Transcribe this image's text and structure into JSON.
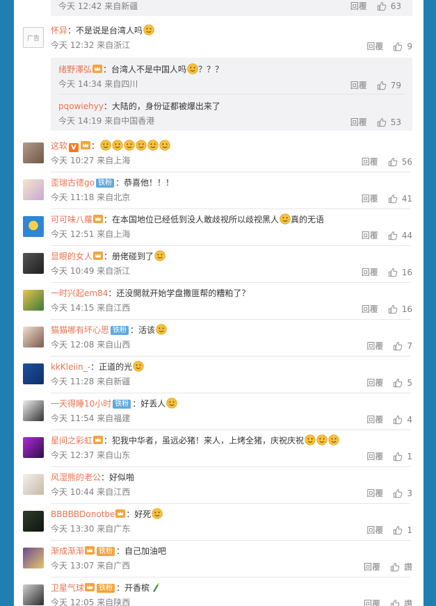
{
  "colors": {
    "page_bg": "#1f7fb3",
    "name": "#eb7350",
    "meta": "#808080",
    "sub_bg": "#f2f2f5"
  },
  "labels": {
    "reply": "回覆"
  },
  "top_sub": {
    "time": "今天 12:42 来自新疆",
    "likes": "63"
  },
  "ad_comment": {
    "avatar_text": "广告",
    "name": "怀异",
    "text": "：不是说是台湾人吗",
    "time": "今天 12:32 来自浙江",
    "likes": "9",
    "replies": [
      {
        "name": "绪野澤弘",
        "text": "：台湾人不是中国人吗",
        "suffix": "？？？",
        "time": "今天 14:34 来自四川",
        "likes": "79"
      },
      {
        "name": "pqowiehyy",
        "text": "：大陆的，身份证都被爆出来了",
        "time": "今天 14:19 来自中国香港",
        "likes": "53"
      }
    ]
  },
  "comments": [
    {
      "name": "这软",
      "text": "：",
      "time": "今天 10:27 来自上海",
      "likes": "56"
    },
    {
      "name": "歪瑞古德go",
      "badge": "铁粉",
      "text": "：恭喜他！！！",
      "time": "今天 11:18 来自北京",
      "likes": "41"
    },
    {
      "name": "可可味八蘿",
      "text": "：在本国地位已经低到没人敢歧视所以歧视黑人",
      "suffix": "真的无语",
      "time": "今天 12:51 来自上海",
      "likes": "44"
    },
    {
      "name": "显眼的女人",
      "text": "：册佬碰到了",
      "time": "今天 10:49 来自浙江",
      "likes": "16"
    },
    {
      "name": "一时兴起em84",
      "text": "：还没開就开始学盘撒匪帮的糟粕了？",
      "time": "今天 14:15 来自江西",
      "likes": "16"
    },
    {
      "name": "猫猫哪有坏心思",
      "badge": "铁粉",
      "text": "：活该",
      "time": "今天 12:08 来自山西",
      "likes": "7"
    },
    {
      "name": "kkKleiin_-",
      "text": "：正道的光",
      "time": "今天 11:28 来自新疆",
      "likes": "5"
    },
    {
      "name": "一天得睡10小时",
      "badge": "铁粉",
      "text": "：好丢人",
      "time": "今天 11:54 来自福建",
      "likes": "4"
    },
    {
      "name": "星间之彩虹",
      "text": "：犯我中华者，虽远必猪！来人，上烤全猪，庆祝庆祝",
      "time": "今天 12:37 来自山东",
      "likes": "1"
    },
    {
      "name": "风湿熊的老公",
      "text": "：好似啪",
      "time": "今天 10:44 来自江西",
      "likes": "3"
    },
    {
      "name": "BBBBBDonotbe",
      "text": "：好死",
      "time": "今天 13:30 来自广东",
      "likes": "1"
    },
    {
      "name": "渐成渐渐",
      "badge": "铁粉",
      "text": "：自己加油吧",
      "time": "今天 13:07 来自广西",
      "likes": "讚"
    },
    {
      "name": "卫星气球",
      "badge": "铁粉",
      "text": "：开香槟",
      "time": "今天 12:05 来自陕西",
      "likes": "讚"
    }
  ]
}
